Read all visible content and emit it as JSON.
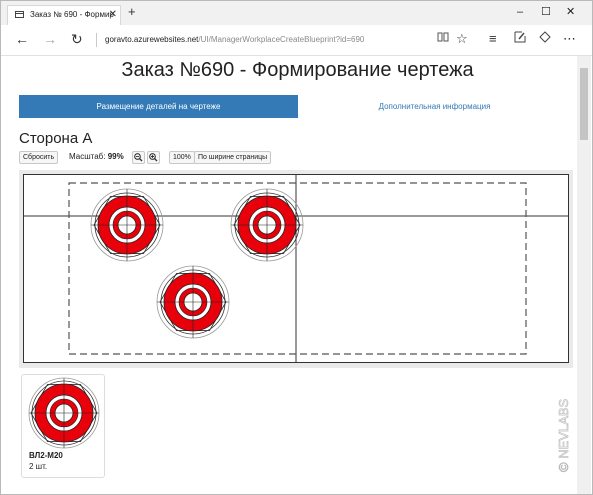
{
  "browser": {
    "tab_title": "Заказ № 690 - Формир",
    "tab_close": "✕",
    "new_tab": "+",
    "url_host": "goravto.azurewebsites.net",
    "url_path": "/UI/ManagerWorkplaceCreateBlueprint?id=690",
    "window_minimize": "–",
    "window_maximize": "☐",
    "window_close": "✕"
  },
  "page": {
    "title": "Заказ №690 - Формирование чертежа",
    "tabs": [
      "Размещение деталей на чертеже",
      "Дополнительная информация"
    ],
    "side_title": "Сторона А",
    "toolbar": {
      "reset": "Сбросить",
      "scale_prefix": "Масштаб:",
      "scale_value": "99%",
      "zoom_out": "🔍",
      "zoom_in": "🔍",
      "zoom_100": "100%",
      "fit_width": "По ширине страницы"
    },
    "part": {
      "name": "ВЛ2-М20",
      "qty": "2 шт."
    },
    "watermark": "© NEVLABS"
  },
  "colors": {
    "accent": "#337ab7",
    "part_red": "#e8000b"
  }
}
